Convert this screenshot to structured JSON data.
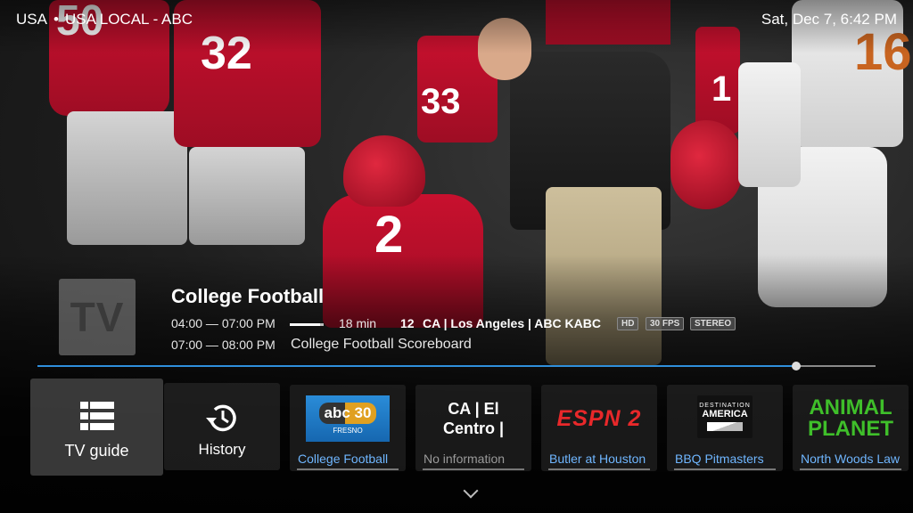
{
  "top": {
    "region": "USA",
    "separator": "•",
    "channel": "USA LOCAL - ABC",
    "clock": "Sat, Dec 7, 6:42 PM"
  },
  "background": {
    "jersey_numbers": [
      "50",
      "32",
      "33",
      "2",
      "1",
      "16"
    ]
  },
  "now": {
    "logo_text": "TV",
    "title": "College Football",
    "time": "04:00 — 07:00 PM",
    "progress": 0.9,
    "remaining": "18 min",
    "channel_number": "12",
    "channel_info": "CA | Los Angeles | ABC KABC",
    "badges": [
      "HD",
      "30 FPS",
      "STEREO"
    ],
    "next_time": "07:00 — 08:00 PM",
    "next_title": "College Football Scoreboard",
    "seek_progress": 0.905
  },
  "tiles": {
    "guide_label": "TV guide",
    "history_label": "History",
    "channels": [
      {
        "logo": "abc 30",
        "logo_sub": "FRESNO",
        "caption": "College Football"
      },
      {
        "logo": "CA | El Centro |",
        "caption": "No information"
      },
      {
        "logo": "ESPN 2",
        "caption": "Butler at Houston"
      },
      {
        "logo_top": "DESTINATION",
        "logo": "AMERICA",
        "caption": "BBQ Pitmasters"
      },
      {
        "logo": "ANIMAL",
        "logo_bottom": "PLANET",
        "caption": "North Woods Law"
      }
    ]
  },
  "colors": {
    "accent": "#2f8fdc",
    "caption": "#6fb6ff",
    "jersey_red": "#c8102e"
  },
  "icons": [
    "list-icon",
    "history-icon",
    "chevron-down-icon"
  ]
}
